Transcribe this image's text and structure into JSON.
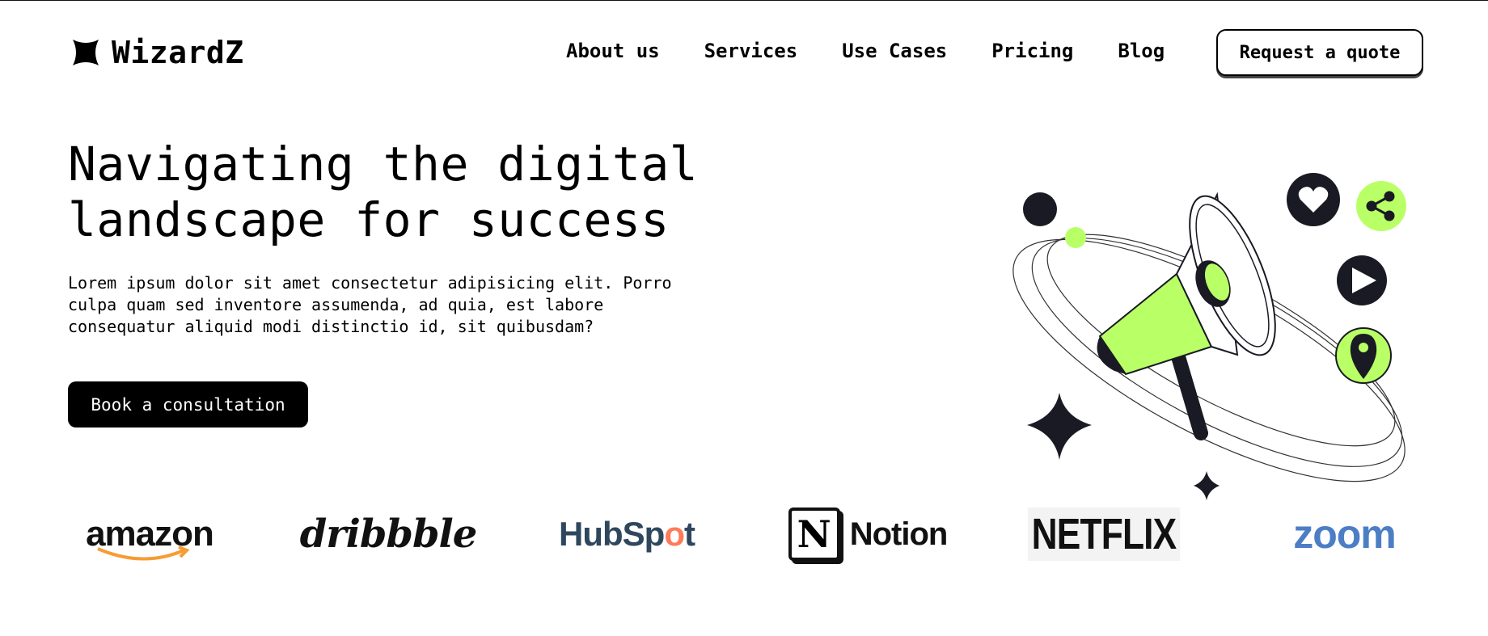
{
  "header": {
    "brand": "WizardZ",
    "nav": [
      "About us",
      "Services",
      "Use Cases",
      "Pricing",
      "Blog"
    ],
    "quote_label": "Request a quote"
  },
  "hero": {
    "title_line1": "Navigating the digital",
    "title_line2": "landscape for success",
    "description": "Lorem ipsum dolor sit amet consectetur adipisicing elit. Porro culpa quam sed inventore assumenda, ad quia, est labore consequatur aliquid modi distinctio id, sit quibusdam?",
    "cta_label": "Book a consultation",
    "illustration_icons": [
      "megaphone-icon",
      "heart-icon",
      "share-icon",
      "play-icon",
      "location-pin-icon",
      "sparkle-icon"
    ]
  },
  "brands": {
    "amazon": "amazon",
    "dribbble": "dribbble",
    "hubspot_a": "HubSp",
    "hubspot_b": "o",
    "hubspot_c": "t",
    "notion_mark": "N",
    "notion": "Notion",
    "netflix": "NETFLIX",
    "zoom": "zoom"
  },
  "colors": {
    "accent": "#B9FF66",
    "dark": "#191A23",
    "hubspot": "#FF7A59",
    "zoom": "#4B7EC5"
  }
}
